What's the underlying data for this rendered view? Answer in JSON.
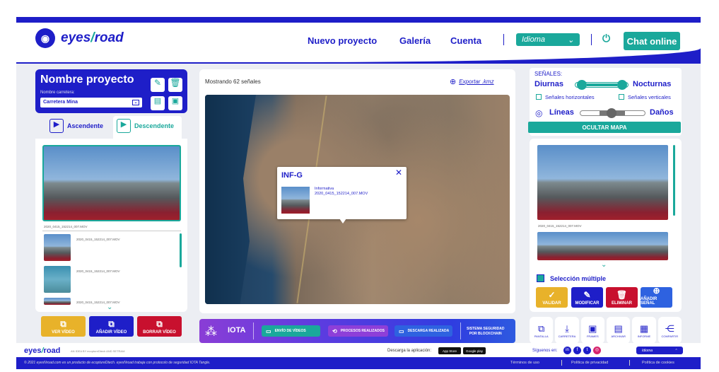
{
  "header": {
    "logo": "eyes∕road",
    "logo_a": "eyes",
    "logo_b": "/",
    "logo_c": "road",
    "nav": [
      "Nuevo proyecto",
      "Galería",
      "Cuenta"
    ],
    "language": "Idioma",
    "chat": "Chat online"
  },
  "project": {
    "title": "Nombre proyecto",
    "road_label": "Nombre carretera:",
    "road_value": "Carretera Mina",
    "tabs": [
      "Ascendente",
      "Descendente"
    ],
    "active_tab": "Descendente",
    "main_video": "2020_0415_152214_007.MOV",
    "videos": [
      "2020_0415_152214_007.MOV",
      "2020_0415_152214_007.MOV",
      "2020_0415_152214_007.MOV"
    ],
    "buttons": [
      "VER VÍDEO",
      "AÑADIR VÍDEO",
      "BORRAR VÍDEO"
    ]
  },
  "map": {
    "count_text": "Mostrando 62 señales",
    "export": "Exportar .kmz",
    "popup_title": "INF-G",
    "popup_type": "Informativa",
    "popup_file": "2020_0415_152214_007.MOV"
  },
  "iota": {
    "label": "IOTA",
    "steps": [
      "ENVÍO DE VÍDEOS",
      "PROCESOS REALIZADOS",
      "DESCARGA REALIZADA"
    ],
    "security_1": "SISTEMA SEGURIDAD",
    "security_2": "POR BLOCKCHAIN"
  },
  "signals": {
    "heading": "SEÑALES:",
    "day": "Diurnas",
    "night": "Nocturnas",
    "horizontal": "Señales horizontales",
    "vertical": "Señales verticales",
    "lines": "Líneas",
    "damage": "Daños",
    "hide_map": "OCULTAR MAPA",
    "video_file": "2020_0415_152214_007.MOV",
    "multi": "Selección múltiple",
    "actions": [
      "VALIDAR",
      "MODIFICAR",
      "ELIMINAR",
      "AÑADIR SEÑAL"
    ],
    "tools": [
      "PANTALLA",
      "CARRETERA",
      "FRAMES",
      "ARCHIVAR",
      "INFORME",
      "COMPARTIR"
    ]
  },
  "footer": {
    "tagline": "AN IDEA BY ecoptureDtech AND SETRAM",
    "download": "Descarga la aplicación:",
    "appstore": "App Store",
    "googleplay": "Google play",
    "follow": "Síguenos en:",
    "language": "Idioma",
    "copyright": "© 2021 eyesNroad.com es un producto de ecoptureDtech. eyesNroad trabaja con protocolo de seguridad IOTA Tangle.",
    "links": [
      "Términos de uso",
      "Política de privacidad",
      "Política de cookies"
    ]
  },
  "colors": {
    "brand": "#1e1ec8",
    "teal": "#1aa89b",
    "yellow": "#e8b22a",
    "red": "#c8102e",
    "purple": "#7a3bd6"
  }
}
